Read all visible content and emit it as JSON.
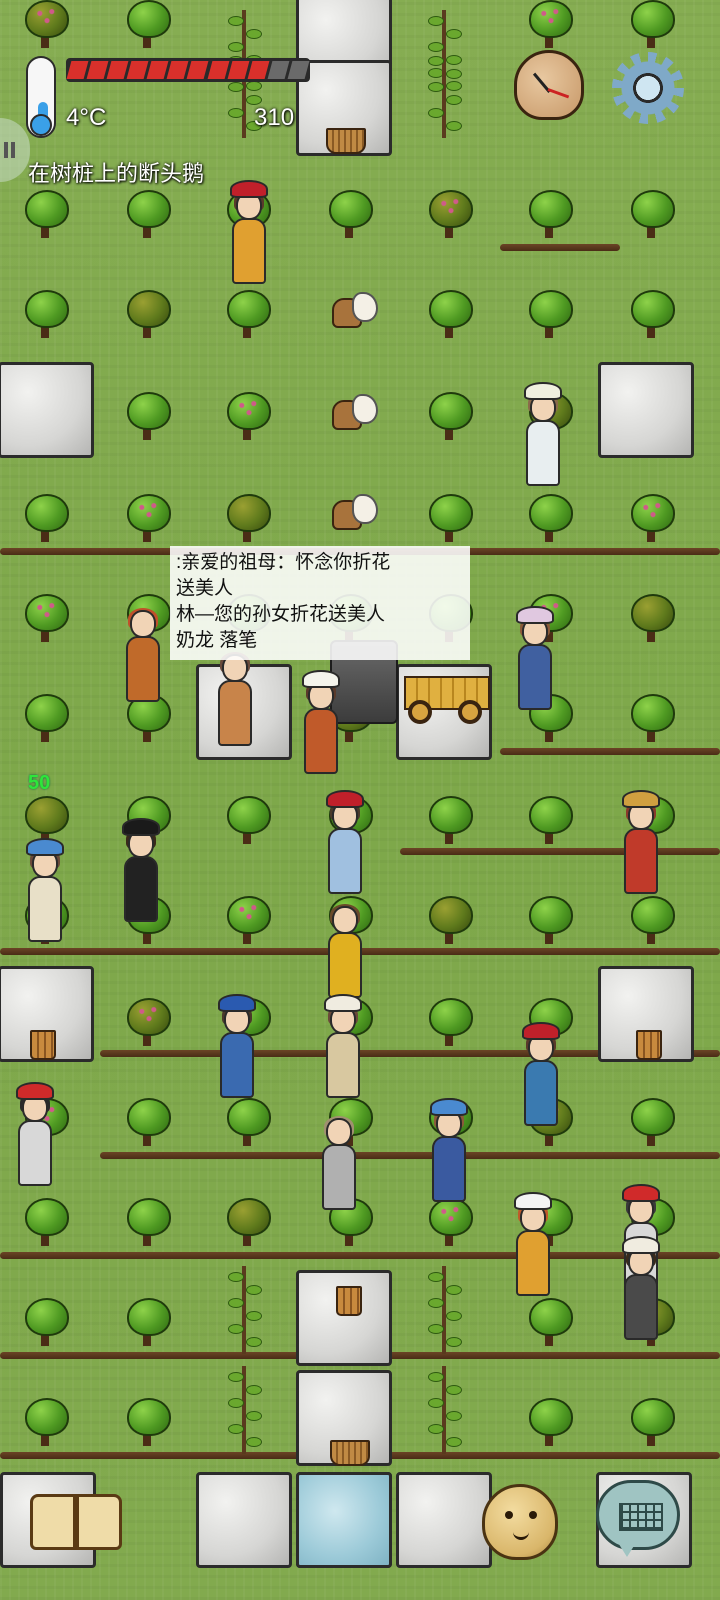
{
  "hud": {
    "temperature": "4°C",
    "temperature_icon": "thermometer-icon",
    "food_pips_total": 12,
    "food_pips_filled": 10,
    "age": "310",
    "hover_object": "在树桩上的断头鹅",
    "clock_icon": "clock-icon",
    "settings_icon": "gear-icon",
    "yum_bonus": "50"
  },
  "speech": {
    "lines": [
      ":亲爱的祖母：怀念你折花",
      "送美人",
      "林—您的孙女折花送美人",
      "奶龙 落笔"
    ]
  },
  "bottom_bar": {
    "tech_book_icon": "book-icon",
    "emote_icon": "potato-face-icon",
    "chat_icon": "keyboard-icon"
  },
  "colors": {
    "grass": "#7fa84c",
    "food_full": "#d9302b",
    "food_empty": "#6a6a6a",
    "yum_text": "#2ee63a"
  }
}
